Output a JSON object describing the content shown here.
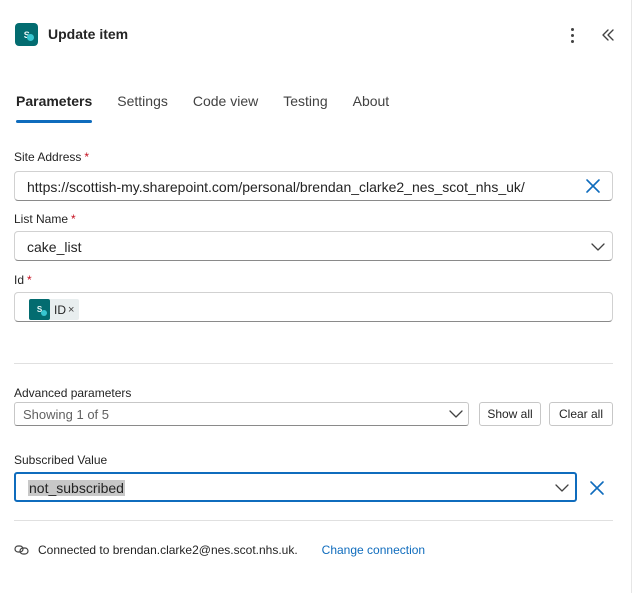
{
  "header": {
    "title": "Update item",
    "icon": "sharepoint-icon",
    "more_icon": "more-vertical-icon",
    "collapse_icon": "double-chevron-left-icon"
  },
  "tabs": [
    {
      "label": "Parameters",
      "active": true
    },
    {
      "label": "Settings",
      "active": false
    },
    {
      "label": "Code view",
      "active": false
    },
    {
      "label": "Testing",
      "active": false
    },
    {
      "label": "About",
      "active": false
    }
  ],
  "fields": {
    "site_address": {
      "label": "Site Address",
      "required": "*",
      "value": "https://scottish-my.sharepoint.com/personal/brendan_clarke2_nes_scot_nhs_uk/"
    },
    "list_name": {
      "label": "List Name",
      "required": "*",
      "value": "cake_list"
    },
    "id": {
      "label": "Id",
      "required": "*",
      "token_label": "ID",
      "token_remove": "×"
    }
  },
  "advanced": {
    "label": "Advanced parameters",
    "selected": "Showing 1 of 5",
    "show_all": "Show all",
    "clear_all": "Clear all"
  },
  "subscribed": {
    "label": "Subscribed Value",
    "value": "not_subscribed"
  },
  "footer": {
    "connected_text": "Connected to brendan.clarke2@nes.scot.nhs.uk.",
    "change_connection": "Change connection"
  },
  "colors": {
    "accent": "#0f6cbd",
    "sharepoint_teal": "#036c70",
    "required": "#c50f1f"
  }
}
